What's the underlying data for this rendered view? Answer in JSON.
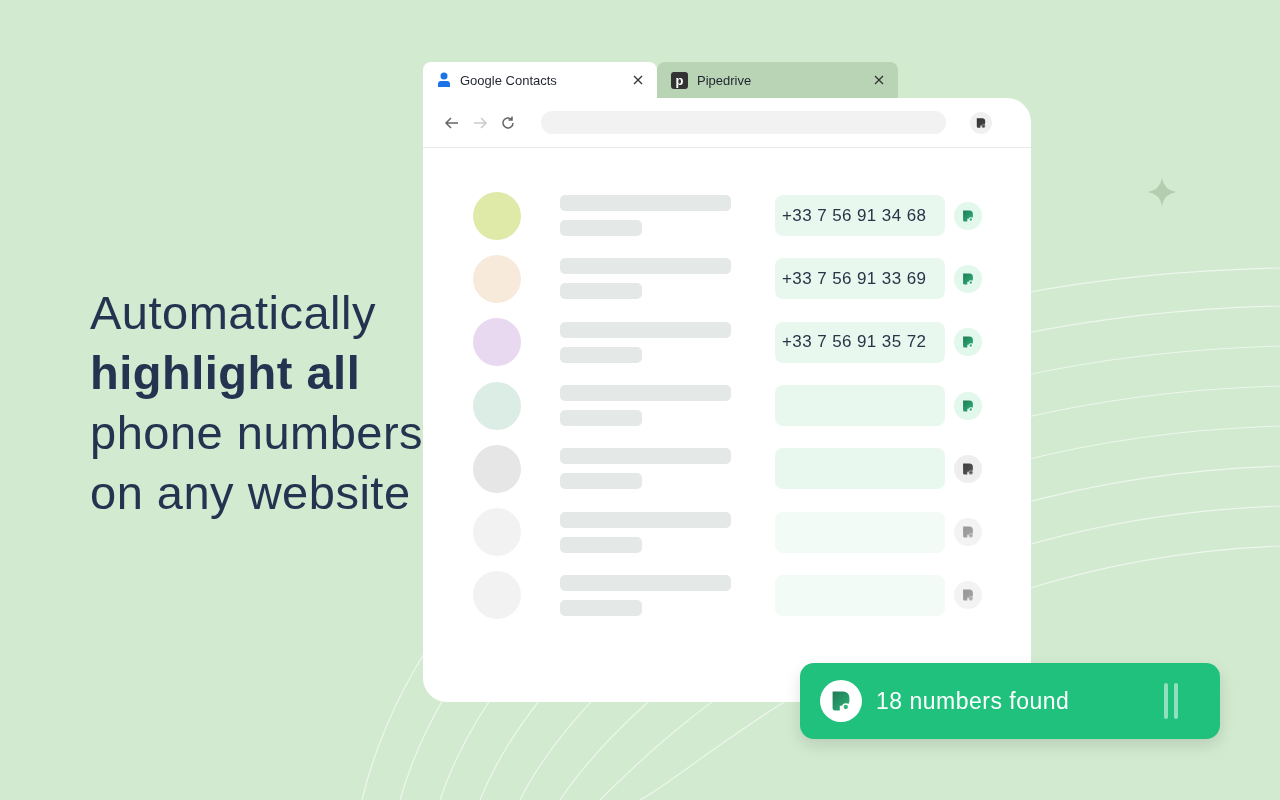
{
  "headline": "Automatically **highlight all** phone numbers on any website",
  "tabs": [
    {
      "label": "Google Contacts",
      "selected": true,
      "kind": "person"
    },
    {
      "label": "Pipedrive",
      "selected": false,
      "kind": "letter",
      "letter": "p"
    }
  ],
  "rows": [
    {
      "color": "#e0eaa8",
      "phone": "+33 7 56 91 34 68",
      "kind": "found"
    },
    {
      "color": "#f8eadb",
      "phone": "+33 7 56 91 33 69",
      "kind": "found"
    },
    {
      "color": "#e8d9f0",
      "phone": "+33 7 56 91 35 72",
      "kind": "found"
    },
    {
      "color": "#dcede6",
      "kind": "found"
    },
    {
      "color": "#e6e6e6",
      "kind": "idle"
    },
    {
      "color": "#f2f2f2",
      "kind": "faded"
    },
    {
      "color": "#f2f2f2",
      "kind": "faded"
    }
  ],
  "toast": {
    "text": "18 numbers found"
  }
}
